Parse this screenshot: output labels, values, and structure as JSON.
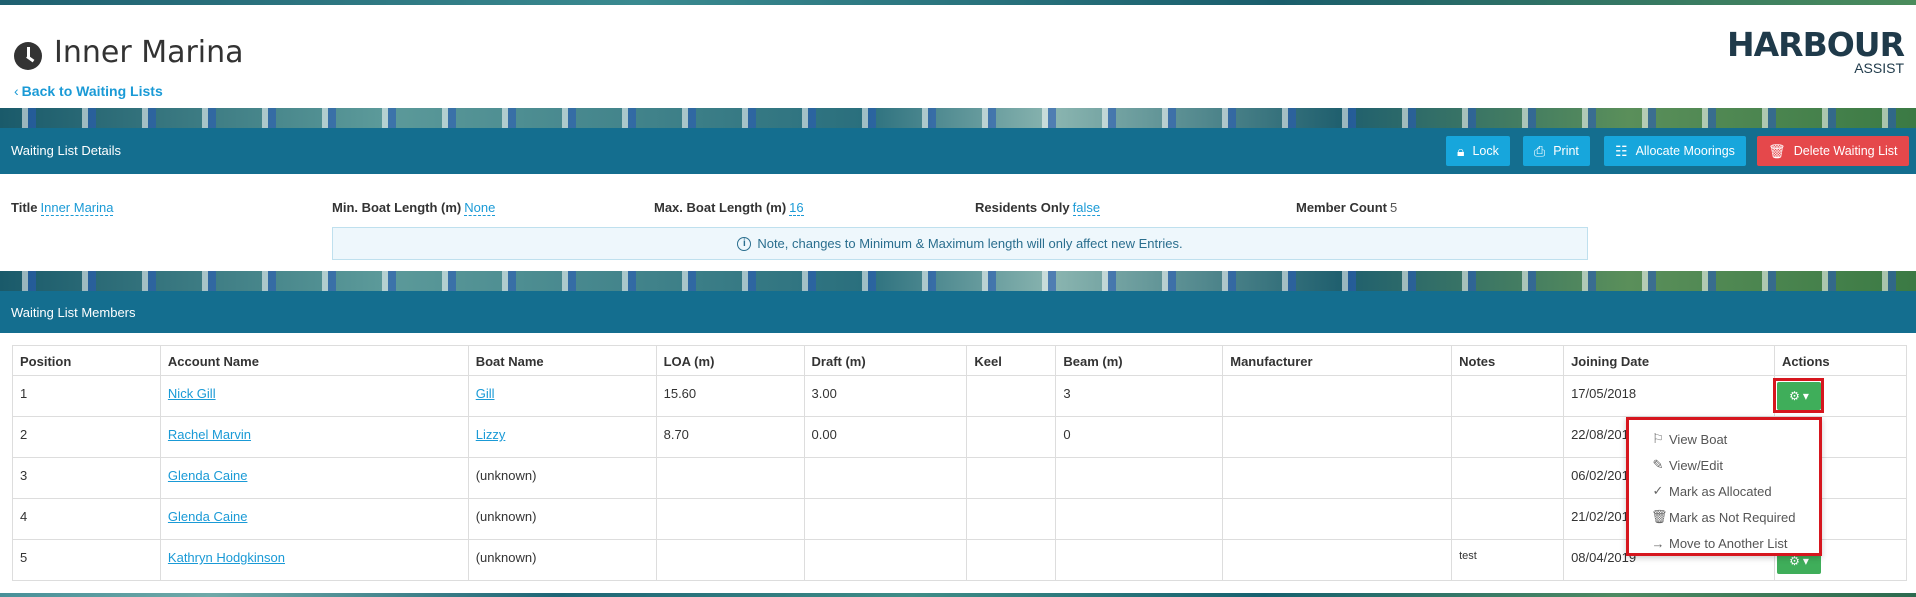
{
  "header": {
    "title": "Inner Marina",
    "back_link": "Back to Waiting Lists",
    "logo_main": "HARBOUR",
    "logo_sub": "ASSIST"
  },
  "details_panel": {
    "title": "Waiting List Details",
    "buttons": {
      "lock": "Lock",
      "print": "Print",
      "allocate": "Allocate Moorings",
      "delete": "Delete Waiting List"
    },
    "fields": {
      "title_label": "Title",
      "title_value": "Inner Marina",
      "min_label": "Min. Boat Length (m)",
      "min_value": "None",
      "max_label": "Max. Boat Length (m)",
      "max_value": "16",
      "residents_label": "Residents Only",
      "residents_value": "false",
      "count_label": "Member Count",
      "count_value": "5"
    },
    "note": "Note, changes to Minimum & Maximum length will only affect new Entries."
  },
  "members_panel": {
    "title": "Waiting List Members",
    "columns": [
      "Position",
      "Account Name",
      "Boat Name",
      "LOA (m)",
      "Draft (m)",
      "Keel",
      "Beam (m)",
      "Manufacturer",
      "Notes",
      "Joining Date",
      "Actions"
    ],
    "rows": [
      {
        "position": "1",
        "account": "Nick Gill",
        "boat": "Gill",
        "boat_link": true,
        "loa": "15.60",
        "draft": "3.00",
        "keel": "",
        "beam": "3",
        "manufacturer": "",
        "notes": "",
        "joining": "17/05/2018"
      },
      {
        "position": "2",
        "account": "Rachel Marvin",
        "boat": "Lizzy",
        "boat_link": true,
        "loa": "8.70",
        "draft": "0.00",
        "keel": "",
        "beam": "0",
        "manufacturer": "",
        "notes": "",
        "joining": "22/08/2018"
      },
      {
        "position": "3",
        "account": "Glenda Caine",
        "boat": "(unknown)",
        "boat_link": false,
        "loa": "",
        "draft": "",
        "keel": "",
        "beam": "",
        "manufacturer": "",
        "notes": "",
        "joining": "06/02/2019"
      },
      {
        "position": "4",
        "account": "Glenda Caine",
        "boat": "(unknown)",
        "boat_link": false,
        "loa": "",
        "draft": "",
        "keel": "",
        "beam": "",
        "manufacturer": "",
        "notes": "",
        "joining": "21/02/2019"
      },
      {
        "position": "5",
        "account": "Kathryn Hodgkinson",
        "boat": "(unknown)",
        "boat_link": false,
        "loa": "",
        "draft": "",
        "keel": "",
        "beam": "",
        "manufacturer": "",
        "notes": "test",
        "joining": "08/04/2019"
      }
    ]
  },
  "actions_menu": {
    "items": [
      {
        "label": "View Boat",
        "icon": "flag-icon"
      },
      {
        "label": "View/Edit",
        "icon": "edit-icon"
      },
      {
        "label": "Mark as Allocated",
        "icon": "check-icon"
      },
      {
        "label": "Mark as Not Required",
        "icon": "trash-icon"
      },
      {
        "label": "Move to Another List",
        "icon": "arrow-right-icon"
      }
    ]
  },
  "colors": {
    "panel_header": "#146e8f",
    "button_blue": "#17a6dc",
    "button_red": "#e5484b",
    "action_green": "#3fae5a",
    "highlight_red": "#d6161e",
    "link": "#1a9ad6"
  }
}
